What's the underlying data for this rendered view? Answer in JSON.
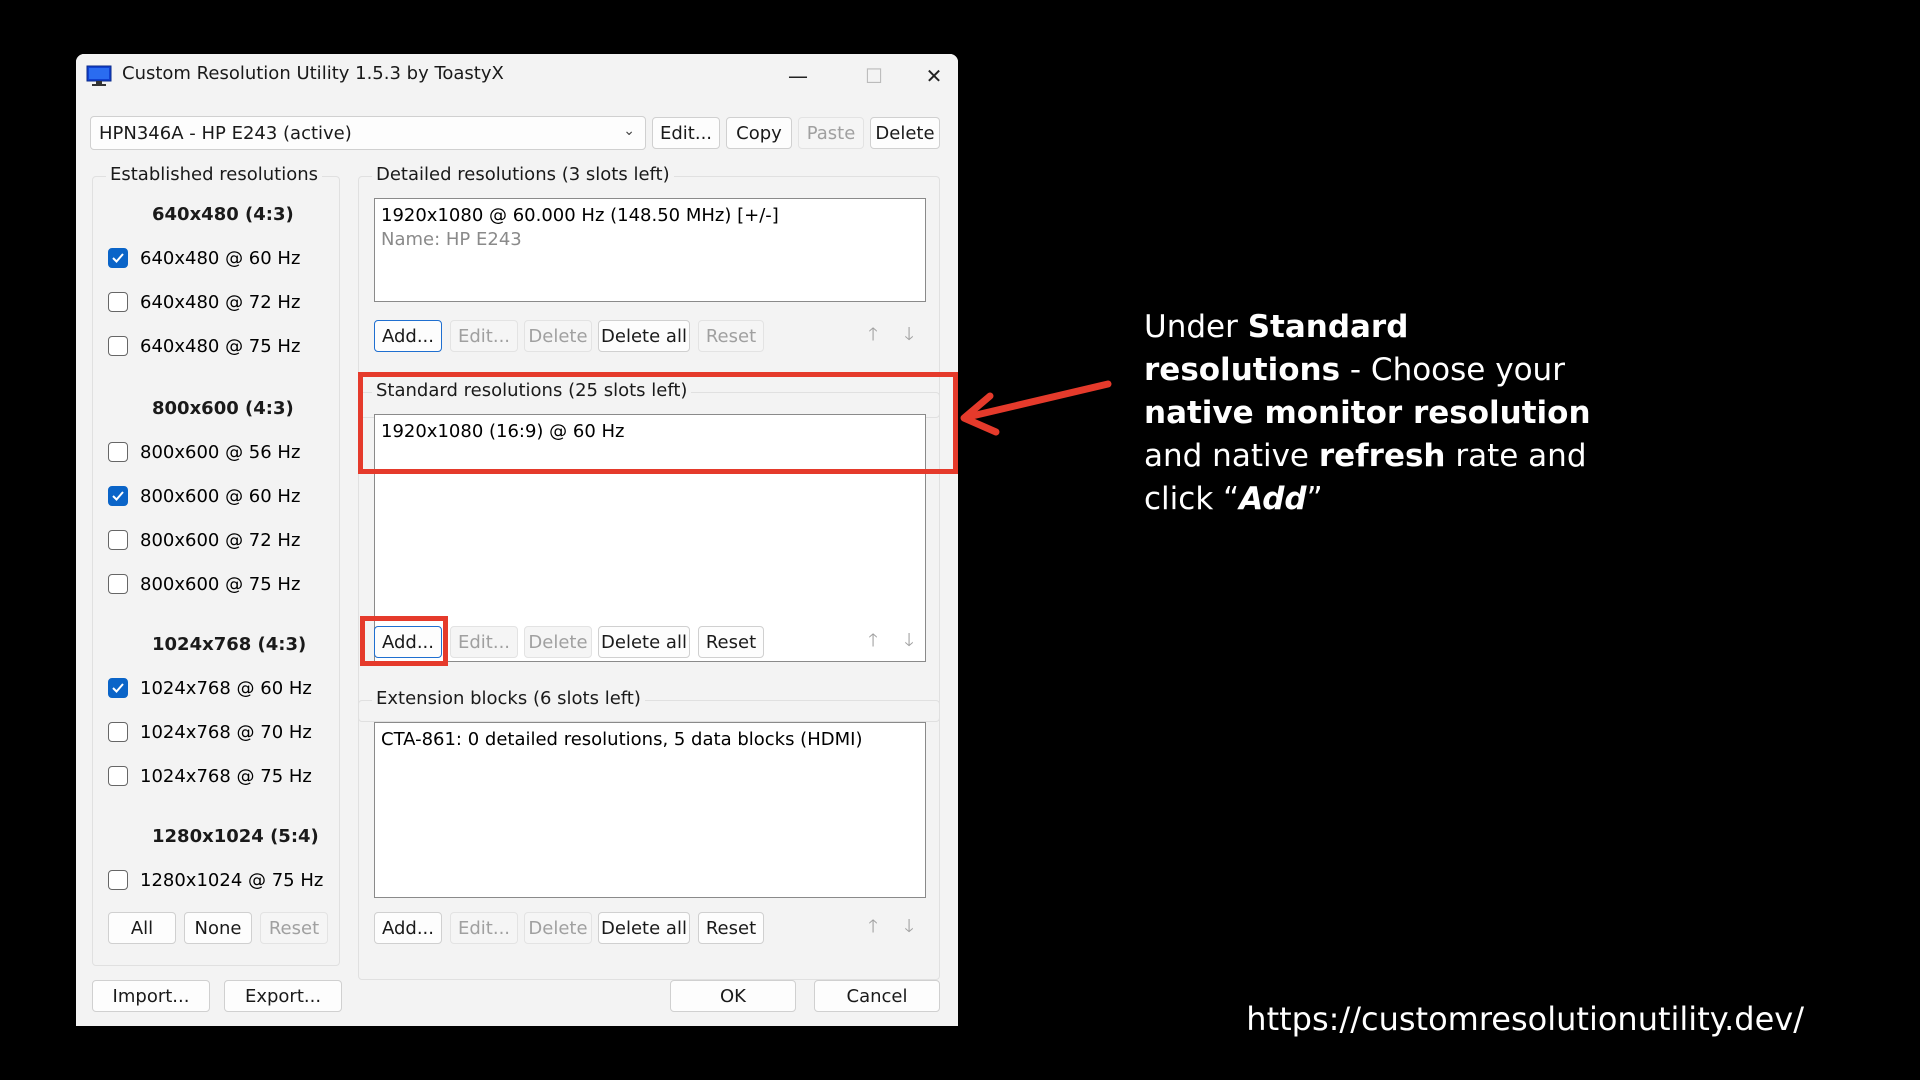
{
  "window": {
    "title": "Custom Resolution Utility 1.5.3 by ToastyX",
    "controls": {
      "minimize": "—",
      "maximize": "☐",
      "close": "✕"
    }
  },
  "monitor": {
    "selected": "HPN346A - HP E243 (active)",
    "buttons": {
      "edit": "Edit...",
      "copy": "Copy",
      "paste": "Paste",
      "delete": "Delete"
    }
  },
  "established": {
    "title": "Established resolutions",
    "groups": [
      {
        "heading": "640x480 (4:3)",
        "items": [
          {
            "label": "640x480 @ 60 Hz",
            "checked": true
          },
          {
            "label": "640x480 @ 72 Hz",
            "checked": false
          },
          {
            "label": "640x480 @ 75 Hz",
            "checked": false
          }
        ]
      },
      {
        "heading": "800x600 (4:3)",
        "items": [
          {
            "label": "800x600 @ 56 Hz",
            "checked": false
          },
          {
            "label": "800x600 @ 60 Hz",
            "checked": true
          },
          {
            "label": "800x600 @ 72 Hz",
            "checked": false
          },
          {
            "label": "800x600 @ 75 Hz",
            "checked": false
          }
        ]
      },
      {
        "heading": "1024x768 (4:3)",
        "items": [
          {
            "label": "1024x768 @ 60 Hz",
            "checked": true
          },
          {
            "label": "1024x768 @ 70 Hz",
            "checked": false
          },
          {
            "label": "1024x768 @ 75 Hz",
            "checked": false
          }
        ]
      },
      {
        "heading": "1280x1024 (5:4)",
        "items": [
          {
            "label": "1280x1024 @ 75 Hz",
            "checked": false
          }
        ]
      }
    ],
    "buttons": {
      "all": "All",
      "none": "None",
      "reset": "Reset"
    }
  },
  "detailed": {
    "title": "Detailed resolutions (3 slots left)",
    "entry": "1920x1080 @ 60.000 Hz (148.50 MHz) [+/-]",
    "entry_name": "Name: HP E243",
    "buttons": {
      "add": "Add...",
      "edit": "Edit...",
      "delete": "Delete",
      "delete_all": "Delete all",
      "reset": "Reset"
    }
  },
  "standard": {
    "title": "Standard resolutions (25 slots left)",
    "entry": "1920x1080 (16:9) @ 60 Hz",
    "buttons": {
      "add": "Add...",
      "edit": "Edit...",
      "delete": "Delete",
      "delete_all": "Delete all",
      "reset": "Reset"
    }
  },
  "extension": {
    "title": "Extension blocks (6 slots left)",
    "entry": "CTA-861: 0 detailed resolutions, 5 data blocks (HDMI)",
    "buttons": {
      "add": "Add...",
      "edit": "Edit...",
      "delete": "Delete",
      "delete_all": "Delete all",
      "reset": "Reset"
    }
  },
  "footer": {
    "import": "Import...",
    "export": "Export...",
    "ok": "OK",
    "cancel": "Cancel"
  },
  "arrows": {
    "up": "🡑",
    "down": "🡓"
  },
  "annotation": {
    "t1": "Under ",
    "b1": "Standard resolutions",
    "t2": " - Choose your ",
    "b2": "native monitor resolution",
    "t3": " and native ",
    "b3": "refresh",
    "t4": " rate and click “",
    "b4": "Add",
    "t5": "”"
  },
  "url": "https://customresolutionutility.dev/",
  "colors": {
    "highlight": "#e53a2b",
    "checkbox": "#0a64c8",
    "background": "#000000"
  }
}
